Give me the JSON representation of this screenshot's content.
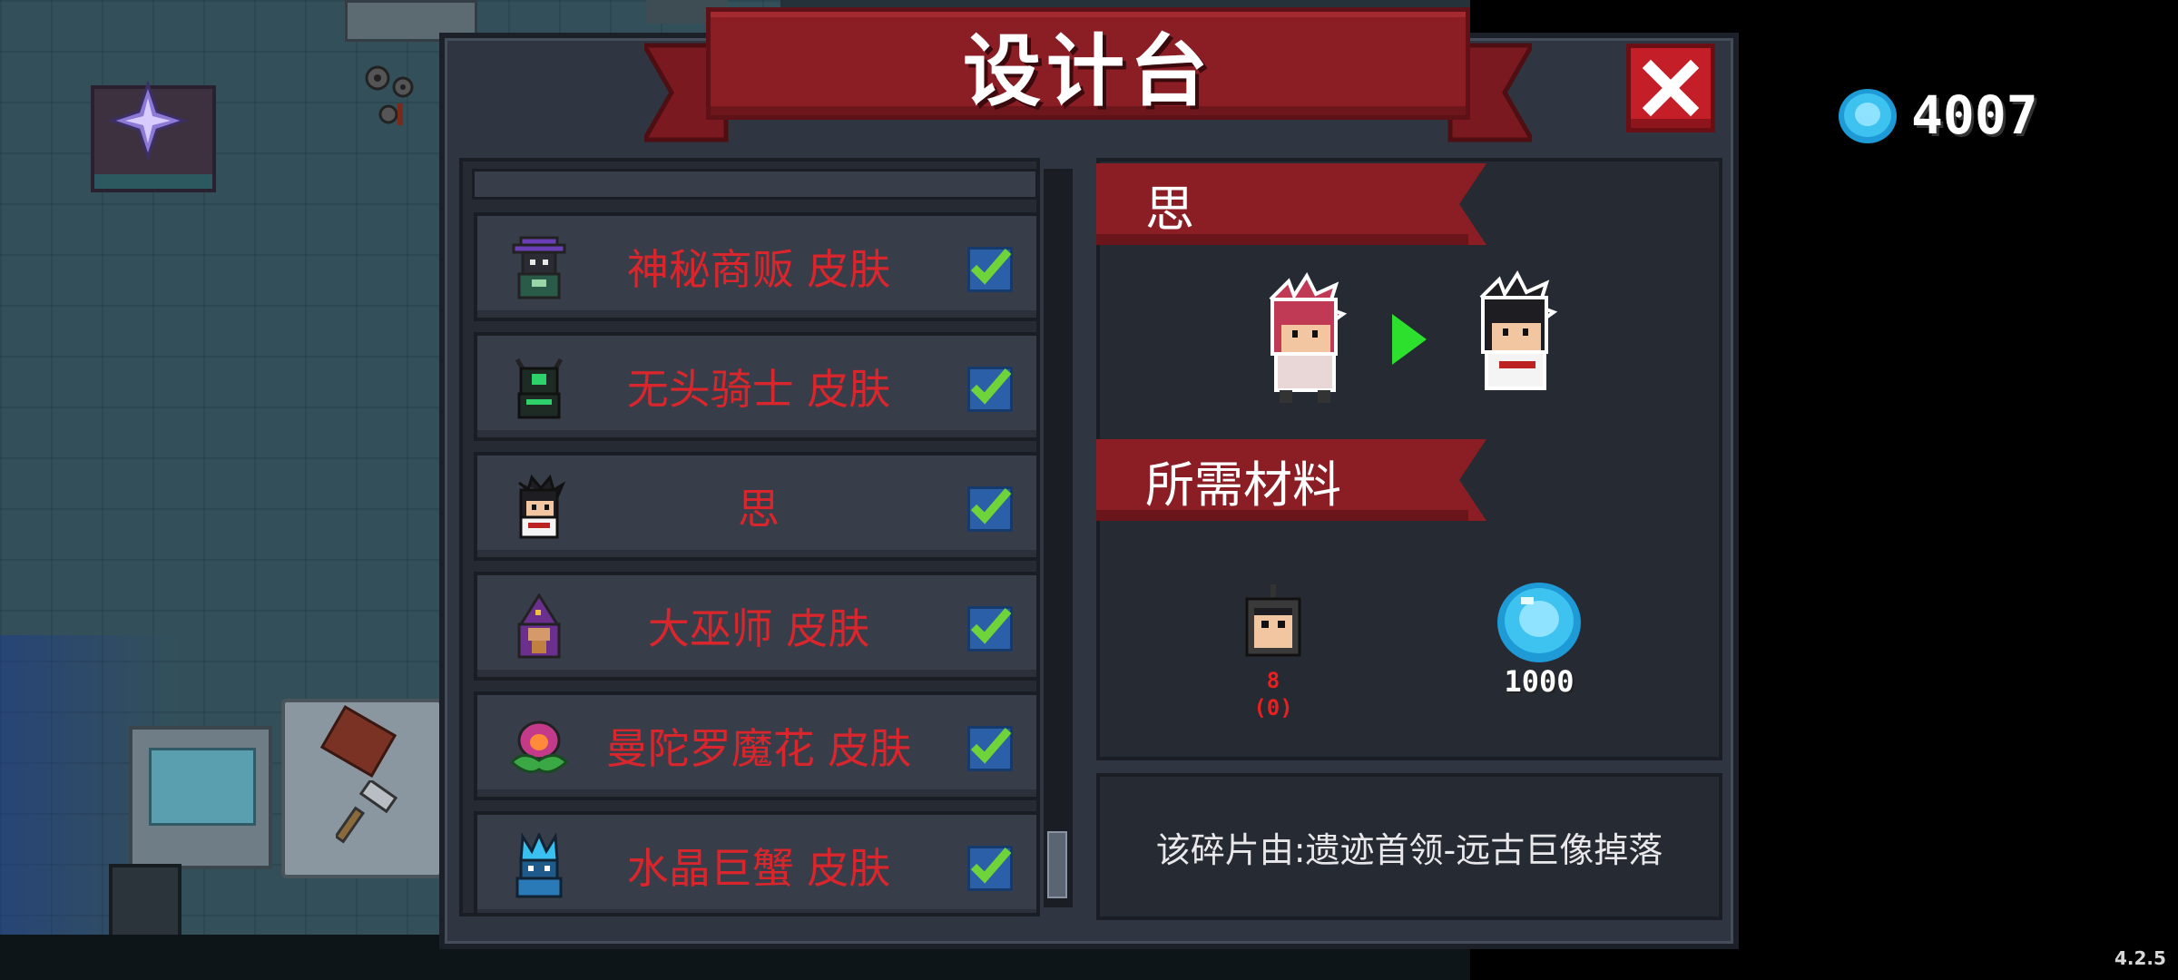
{
  "dialog": {
    "title": "设计台"
  },
  "list": {
    "items": [
      {
        "label": "神秘商贩 皮肤",
        "icon": "mystery-merchant-avatar-icon",
        "checked": true
      },
      {
        "label": "无头骑士 皮肤",
        "icon": "headless-knight-avatar-icon",
        "checked": true
      },
      {
        "label": "思",
        "icon": "si-avatar-icon",
        "checked": true
      },
      {
        "label": "大巫师 皮肤",
        "icon": "grand-wizard-avatar-icon",
        "checked": true
      },
      {
        "label": "曼陀罗魔花 皮肤",
        "icon": "mandrake-flower-avatar-icon",
        "checked": true
      },
      {
        "label": "水晶巨蟹 皮肤",
        "icon": "crystal-crab-avatar-icon",
        "checked": true
      }
    ]
  },
  "detail": {
    "name": "思",
    "materials_heading": "所需材料",
    "material_fragment": {
      "required": "8",
      "owned": "(0)"
    },
    "material_gems": {
      "required": "1000"
    },
    "description": "该碎片由:遗迹首领-远古巨像掉落"
  },
  "currency": {
    "gems": "4007"
  },
  "version": "4.2.5",
  "colors": {
    "banner_red": "#8b1e24",
    "label_red": "#d8262c",
    "check_blue": "#2b5fa8",
    "check_green": "#6fd33a",
    "arrow_green": "#2de02d",
    "gem_blue": "#3ec2f0"
  }
}
